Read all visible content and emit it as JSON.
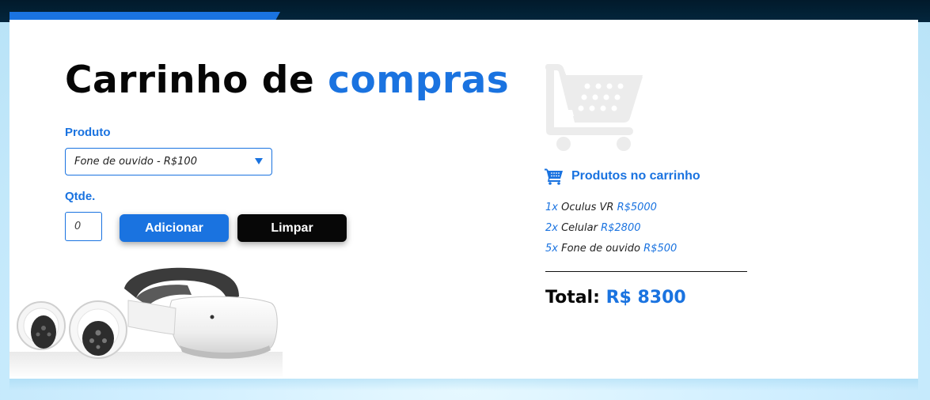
{
  "header": {
    "title_part1": "Carrinho de ",
    "title_part2": "compras"
  },
  "form": {
    "product_label": "Produto",
    "product_selected": "Fone de ouvido - R$100",
    "qty_label": "Qtde.",
    "qty_placeholder": "0",
    "add_button": "Adicionar",
    "clear_button": "Limpar"
  },
  "cart": {
    "heading": "Produtos no carrinho",
    "items": [
      {
        "qty": "1x",
        "name": "Oculus VR",
        "price": "R$5000"
      },
      {
        "qty": "2x",
        "name": "Celular",
        "price": "R$2800"
      },
      {
        "qty": "5x",
        "name": "Fone de ouvido",
        "price": "R$500"
      }
    ],
    "total_label": "Total:",
    "total_value": "R$ 8300"
  },
  "icons": {
    "cart_heading": "shopping-cart-icon",
    "cart_illustration": "shopping-cart-illustration",
    "select_caret": "caret-down-icon",
    "product_image": "vr-headset-image"
  },
  "colors": {
    "accent": "#1a73e0",
    "dark": "#060606",
    "header_bar": "#03263d"
  }
}
